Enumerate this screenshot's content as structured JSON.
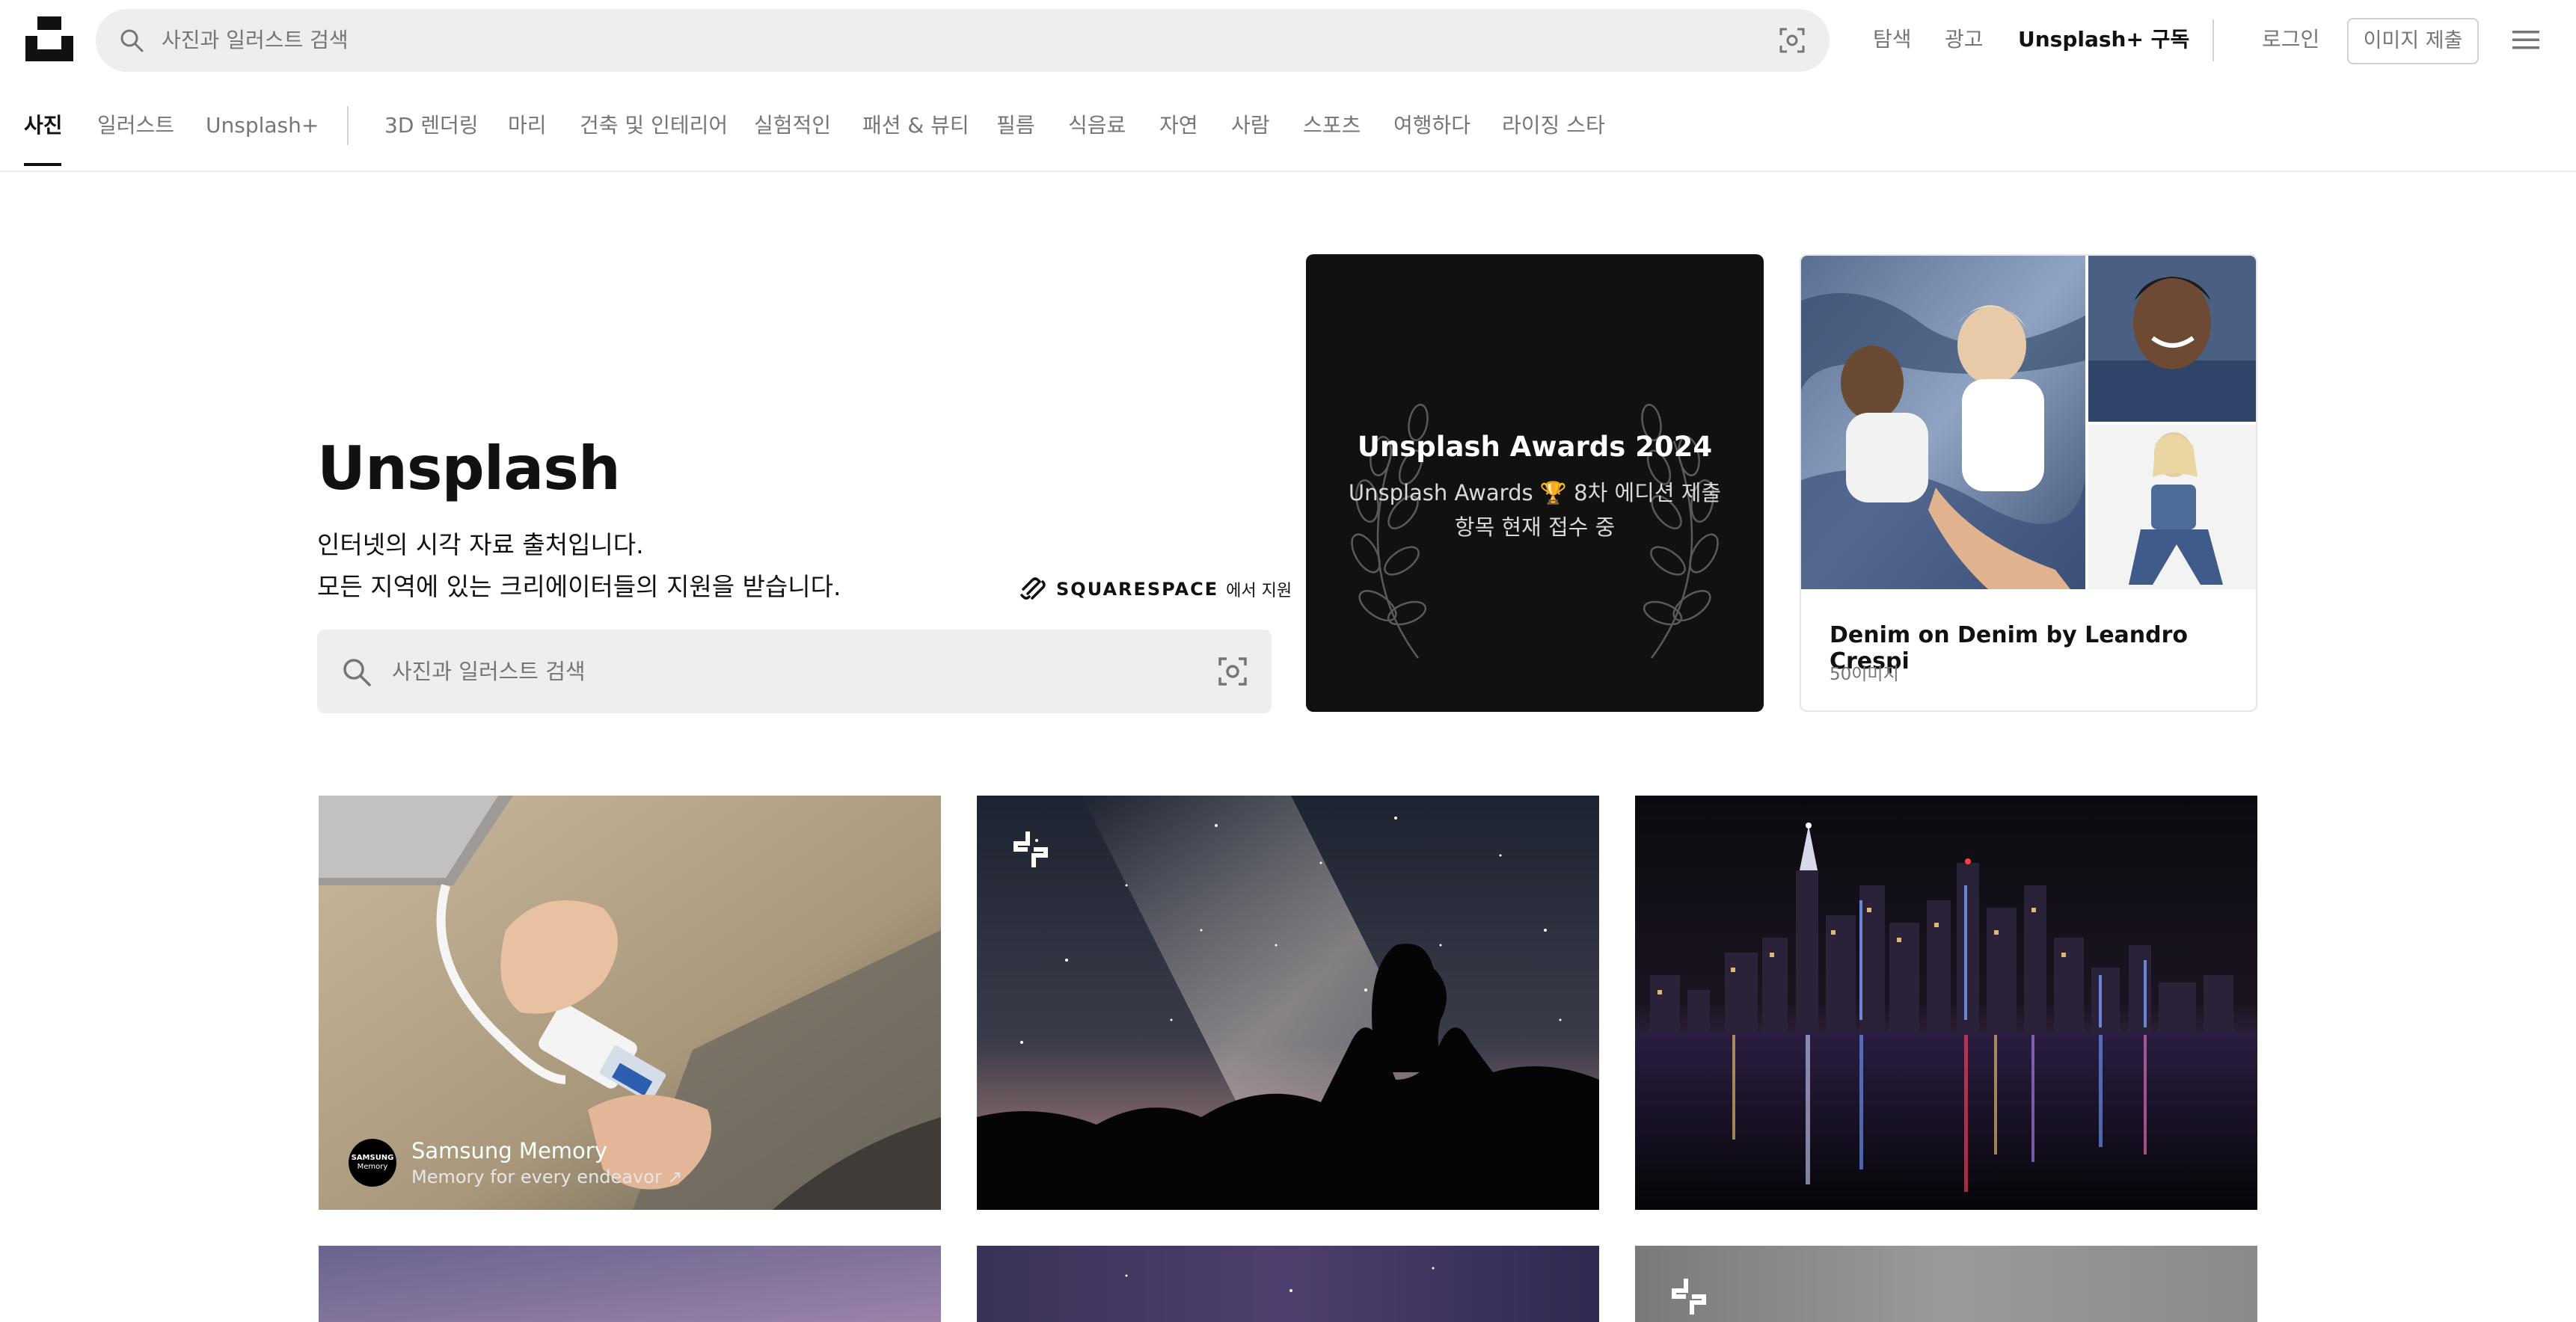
{
  "header": {
    "search_placeholder": "사진과 일러스트 검색",
    "links": {
      "explore": "탐색",
      "advertise": "광고",
      "subscribe": "Unsplash+ 구독",
      "login": "로그인",
      "submit": "이미지 제출"
    }
  },
  "categories": {
    "primary": [
      "사진",
      "일러스트",
      "Unsplash+"
    ],
    "topics": [
      "3D 렌더링",
      "마리",
      "건축 및 인테리어",
      "실험적인",
      "패션 & 뷰티",
      "필름",
      "식음료",
      "자연",
      "사람",
      "스포츠",
      "여행하다",
      "라이징 스타"
    ],
    "active": "사진"
  },
  "hero": {
    "title": "Unsplash",
    "subtitle_line1": "인터넷의 시각 자료 출처입니다.",
    "subtitle_line2": "모든 지역에 있는 크리에이터들의 지원을 받습니다.",
    "sponsor_name": "SQUARESPACE",
    "sponsor_suffix": "에서 지원",
    "search_placeholder": "사진과 일러스트 검색"
  },
  "awards": {
    "title": "Unsplash Awards 2024",
    "line1": "Unsplash Awards 🏆 8차 에디션 제출",
    "line2": "항목 현재 접수 중"
  },
  "collection": {
    "title": "Denim on Denim by Leandro Crespi",
    "count": "50이미지"
  },
  "photos": {
    "sponsored": {
      "avatar_text_1": "SAMSUNG",
      "avatar_text_2": "Memory",
      "name": "Samsung Memory",
      "tagline": "Memory for every endeavor ↗"
    }
  },
  "colors": {
    "accent_dark": "#111111",
    "muted_text": "#767676",
    "search_bg": "#eeeeee"
  }
}
